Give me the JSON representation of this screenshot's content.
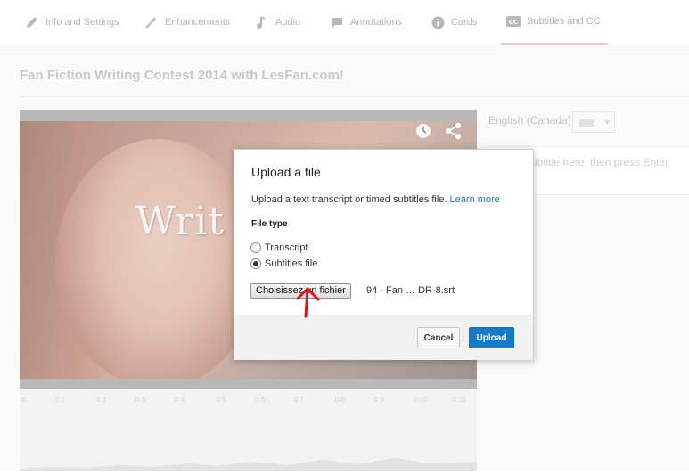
{
  "tabs": [
    {
      "label": "Info and Settings",
      "icon": "pencil-icon"
    },
    {
      "label": "Enhancements",
      "icon": "magic-wand-icon"
    },
    {
      "label": "Audio",
      "icon": "music-note-icon"
    },
    {
      "label": "Annotations",
      "icon": "speech-bubble-icon"
    },
    {
      "label": "Cards",
      "icon": "info-icon"
    },
    {
      "label": "Subtitles and CC",
      "icon": "cc-icon",
      "active": true
    }
  ],
  "video": {
    "title": "Fan Fiction Writing Contest 2014 with LesFan.com!",
    "overlay_text": "Writ",
    "timeline_ticks": [
      "0",
      "0:1",
      "0:2",
      "0:3",
      "0:4",
      "0:5",
      "0:6",
      "0:7",
      "0:8",
      "0:9",
      "0:10",
      "0:11"
    ]
  },
  "editor": {
    "language": "English (Canada)",
    "subtitle_placeholder": "ubtitle here, then press Enter"
  },
  "dialog": {
    "title": "Upload a file",
    "description": "Upload a text transcript or timed subtitles file.",
    "learn_more": "Learn more",
    "file_type_label": "File type",
    "options": [
      {
        "label": "Transcript",
        "selected": false
      },
      {
        "label": "Subtitles file",
        "selected": true
      }
    ],
    "choose_file_label": "Choisissez un fichier",
    "file_name": "94 - Fan … DR-8.srt",
    "cancel_label": "Cancel",
    "upload_label": "Upload"
  },
  "colors": {
    "accent": "#167ac6",
    "annotation_arrow": "#e0121a"
  }
}
